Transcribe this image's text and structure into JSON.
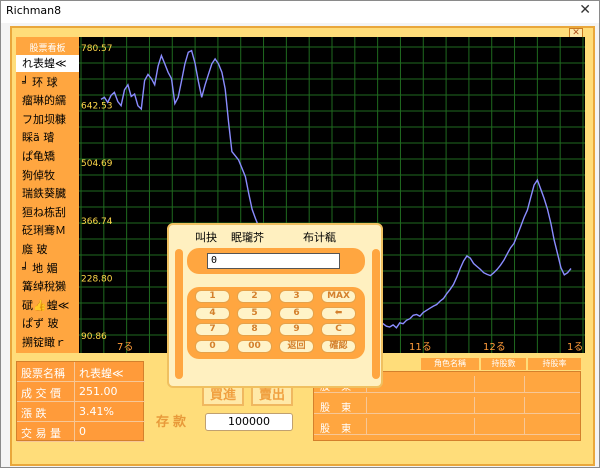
{
  "window": {
    "title": "Richman8",
    "close_glyph": "✕"
  },
  "frame": {
    "close_glyph": "✕"
  },
  "sidebar": {
    "title": "股票看板",
    "items": [
      "れ表蝗≪",
      "╛ 环 球",
      "瘤琳的繻",
      "フ加坝糠",
      "睬ä 璿",
      "ぱ龟矯",
      "狗倬牧",
      "瑞鉄葵臓",
      "狟ね栋刮",
      "砭琍骞Ｍ",
      "廕 玻",
      "╛ 地 媚",
      "篝绰稅獭",
      "碔👍蝗≪",
      "ぱず 玻",
      "搠锭瞰ｒ"
    ],
    "selected_index": 0
  },
  "chart_data": {
    "type": "line",
    "y_ticks": [
      "780.57",
      "642.53",
      "504.69",
      "366.74",
      "228.80",
      "90.86"
    ],
    "x_ticks": [
      "7る",
      "11る",
      "12る",
      "1る"
    ],
    "ylim": [
      90.86,
      780.57
    ],
    "grid": true,
    "line_color": "#8a8cff",
    "values": [
      655,
      660,
      648,
      665,
      672,
      650,
      640,
      678,
      690,
      662,
      668,
      640,
      632,
      700,
      715,
      705,
      690,
      735,
      760,
      740,
      720,
      705,
      645,
      660,
      700,
      740,
      768,
      772,
      742,
      698,
      660,
      690,
      715,
      740,
      752,
      740,
      720,
      680,
      600,
      530,
      520,
      510,
      490,
      470,
      430,
      392,
      370,
      350,
      325,
      310,
      290,
      300,
      285,
      275,
      260,
      250,
      240,
      235,
      228,
      222,
      215,
      205,
      198,
      190,
      182,
      175,
      165,
      160,
      152,
      150,
      142,
      140,
      145,
      150,
      148,
      152,
      150,
      146,
      140,
      138,
      135,
      140,
      138,
      120,
      118,
      112,
      110,
      115,
      108,
      120,
      118,
      126,
      130,
      138,
      140,
      136,
      145,
      150,
      155,
      160,
      164,
      172,
      178,
      190,
      200,
      212,
      230,
      250,
      268,
      280,
      275,
      262,
      255,
      248,
      240,
      236,
      233,
      240,
      248,
      258,
      270,
      285,
      300,
      310,
      330,
      350,
      372,
      390,
      420,
      450,
      462,
      440,
      418,
      392,
      358,
      318,
      285,
      252,
      235,
      240,
      250
    ]
  },
  "info": {
    "rows": [
      {
        "label": "股票名稱",
        "value": "れ表蝗≪"
      },
      {
        "label": "成 交 價",
        "value": "251.00"
      },
      {
        "label": "漲    跌",
        "value": "3.41%"
      },
      {
        "label": "交 易 量",
        "value": "0"
      }
    ]
  },
  "actions": {
    "buy_label": "買進",
    "sell_label": "賣出"
  },
  "deposit": {
    "label": "存款",
    "value": "100000"
  },
  "holders": {
    "headers": [
      "角色名稱",
      "持股數",
      "持股率"
    ],
    "row_labels": [
      "股 東",
      "股 東",
      "股 東"
    ]
  },
  "dialog": {
    "title_left": "叫抉",
    "title_mid": "眠瓏芥",
    "title_right": "布计瓻",
    "input_value": "0",
    "keys": [
      [
        "1",
        "2",
        "3",
        "MAX"
      ],
      [
        "4",
        "5",
        "6",
        "⬅"
      ],
      [
        "7",
        "8",
        "9",
        "C"
      ],
      [
        "0",
        "00",
        "返回",
        "確認"
      ]
    ]
  }
}
